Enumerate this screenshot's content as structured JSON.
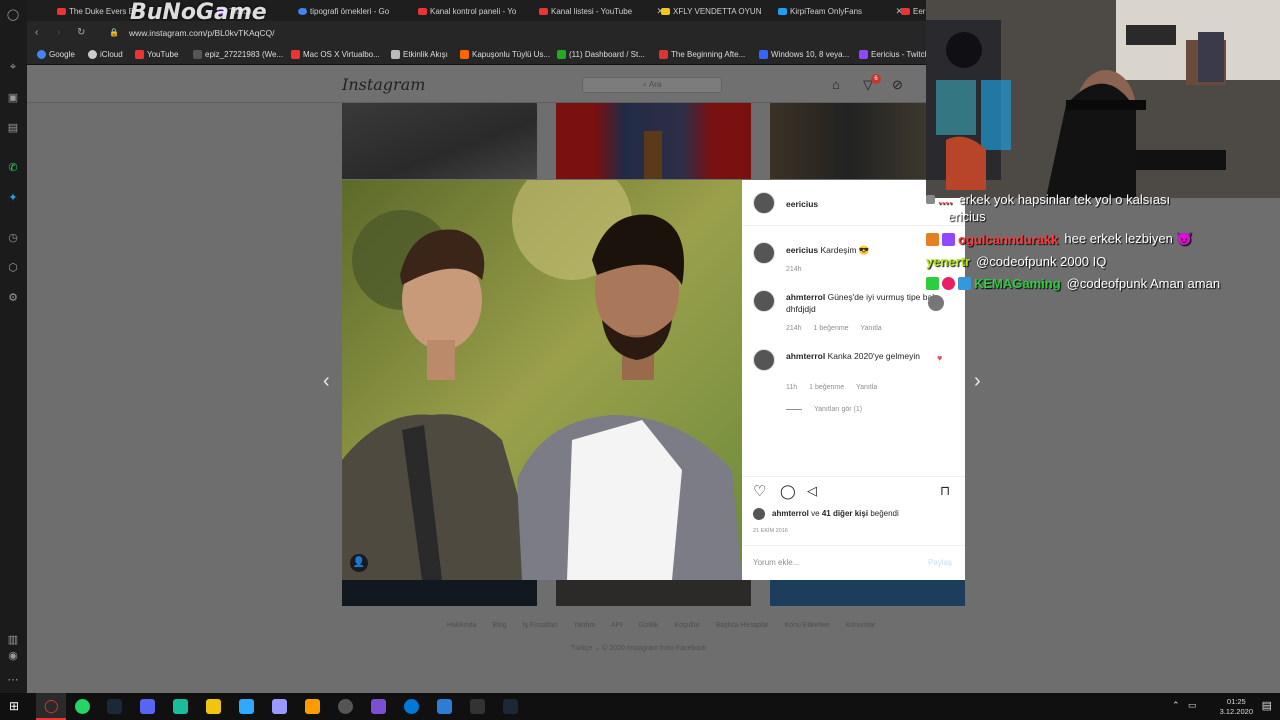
{
  "tabs": [
    {
      "label": "The Duke Evers B",
      "color": "#e33"
    },
    {
      "label": "Twitch",
      "color": "#9146ff"
    },
    {
      "label": "tipografi örnekleri - Go",
      "color": "#4285f4"
    },
    {
      "label": "Kanal kontrol paneli - Yo",
      "color": "#e33"
    },
    {
      "label": "Kanal listesi - YouTube",
      "color": "#e33"
    },
    {
      "label": "XFLY VENDETTA OYUN",
      "color": "#f5c518"
    },
    {
      "label": "KirpiTeam OnlyFans",
      "color": "#1da1f2"
    },
    {
      "label": "Eeri",
      "color": "#e33"
    }
  ],
  "overlay_logo": "BuNoGame",
  "address": {
    "url": "www.instagram.com/p/BL0kvTKAqCQ/"
  },
  "bookmarks": [
    "Google",
    "iCloud",
    "YouTube",
    "epiz_27221983 (We...",
    "Mac OS X Virtualbo...",
    "Etkinlik Akışı",
    "Kapuşonlu Tüylü Us...",
    "(11) Dashboard / St...",
    "The Beginning Afte...",
    "Windows 10, 8 veya...",
    "Eericius - Twitch"
  ],
  "instagram": {
    "logo": "Instagram",
    "search_placeholder": "Ara",
    "notification_count": "6"
  },
  "post": {
    "author": "eericius",
    "caption_user": "eericius",
    "caption_text": "Kardeşim 😎",
    "caption_time": "214h",
    "comments": [
      {
        "user": "ahmterrol",
        "text": "Güneş'de iyi vurmuş tipe bak dhfdjdjd",
        "time": "214h",
        "likes": "1 beğenme",
        "reply": "Yanıtla"
      },
      {
        "user": "ahmterrol",
        "text": "Kanka 2020'ye gelmeyin",
        "time": "11h",
        "likes": "1 beğenme",
        "reply": "Yanıtla"
      }
    ],
    "view_replies": "Yanıtları gör (1)",
    "liked_by_user": "ahmterrol",
    "liked_by_rest": "ve",
    "liked_by_count": "41 diğer kişi",
    "liked_by_suffix": "beğendi",
    "date": "21 EKİM 2016",
    "comment_placeholder": "Yorum ekle...",
    "share_label": "Paylaş"
  },
  "footer": {
    "links": [
      "Hakkında",
      "Blog",
      "İş Fırsatları",
      "Yardım",
      "API",
      "Gizlilik",
      "Koşullar",
      "Başlıca Hesaplar",
      "Konu Etiketleri",
      "Konumlar"
    ],
    "language": "Türkçe",
    "copyright": "© 2020 Instagram from Facebook"
  },
  "chat": [
    {
      "user": "",
      "message": "erkek yok hapsinlar tek yol o kalsıası",
      "color": "#ff4d4d"
    },
    {
      "user": "",
      "message": "ericius",
      "color": "#ffffff"
    },
    {
      "user": "ogulcanndurakk",
      "message": "hee erkek lezbiyen 😈",
      "color": "#ff3b3b"
    },
    {
      "user": "yenertr",
      "message": "@codeofpunk 2000 IQ",
      "color": "#b5e61d"
    },
    {
      "user": "KEMAGaming",
      "message": "@codeofpunk Aman aman",
      "color": "#2ecc40"
    }
  ],
  "clock": {
    "time": "01:25",
    "date": "3.12.2020"
  }
}
